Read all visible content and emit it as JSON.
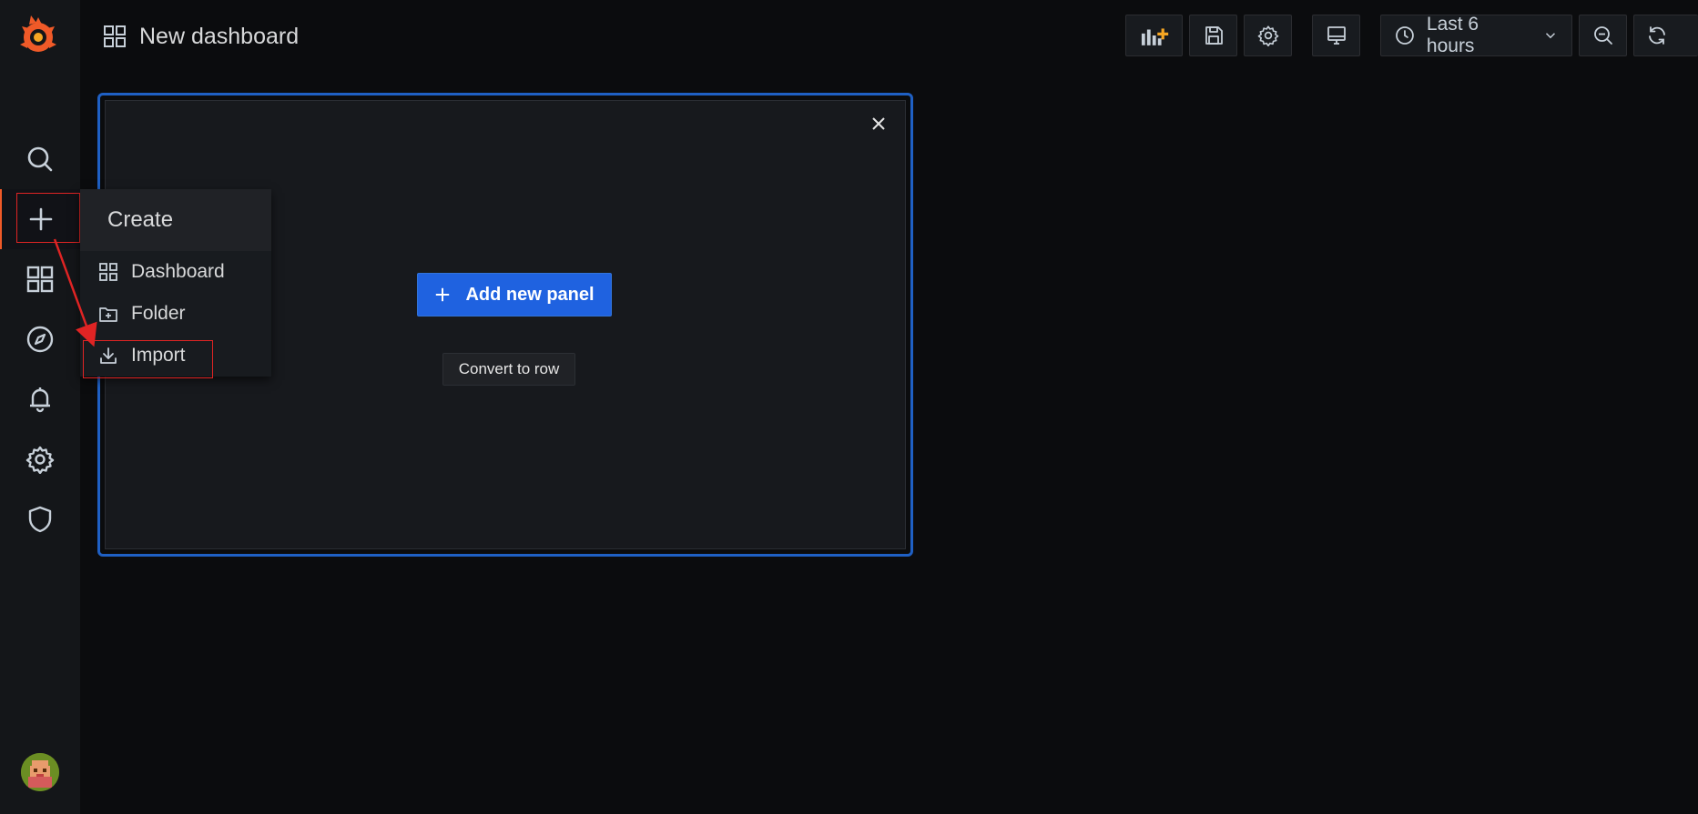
{
  "topbar": {
    "title": "New dashboard",
    "time_range": "Last 6 hours"
  },
  "flyout": {
    "header": "Create",
    "items": [
      {
        "label": "Dashboard",
        "icon": "apps-icon"
      },
      {
        "label": "Folder",
        "icon": "folder-plus-icon"
      },
      {
        "label": "Import",
        "icon": "import-icon"
      }
    ]
  },
  "panel": {
    "add_panel_label": "Add new panel",
    "convert_label": "Convert to row"
  },
  "colors": {
    "accent": "#f05a28",
    "primary_button": "#1f62e0",
    "panel_border": "#1f60c4",
    "annotation": "#e02424"
  }
}
